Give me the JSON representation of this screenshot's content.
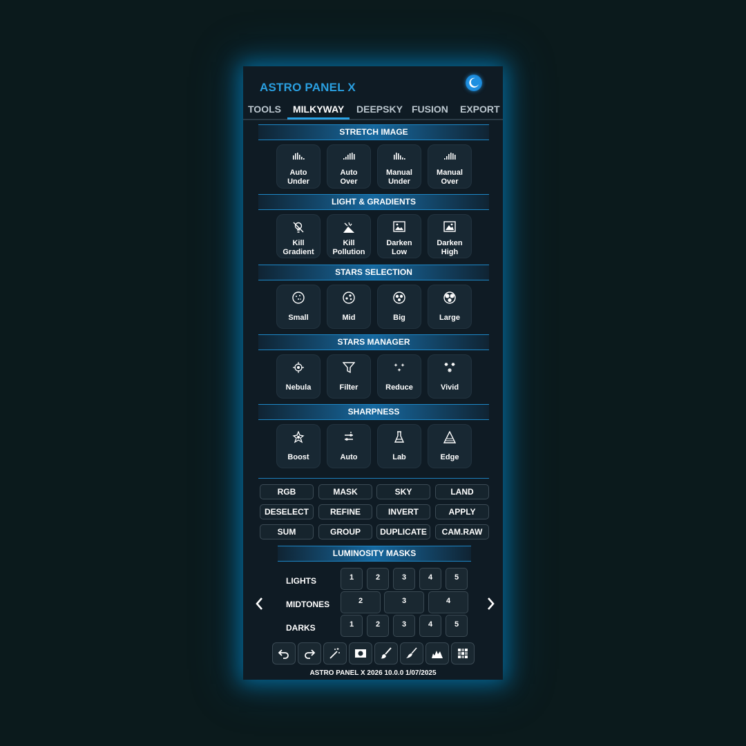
{
  "app": {
    "title": "ASTRO PANEL X",
    "theme_icon": "moon-icon",
    "accent": "#2a9fe0"
  },
  "tabs": [
    {
      "label": "TOOLS"
    },
    {
      "label": "MILKYWAY",
      "active": true
    },
    {
      "label": "DEEPSKY"
    },
    {
      "label": "FUSION"
    },
    {
      "label": "EXPORT"
    }
  ],
  "sections": {
    "stretch": {
      "title": "STRETCH IMAGE",
      "items": [
        {
          "line1": "Auto",
          "line2": "Under",
          "icon": "histogram-icon"
        },
        {
          "line1": "Auto",
          "line2": "Over",
          "icon": "histogram-icon"
        },
        {
          "line1": "Manual",
          "line2": "Under",
          "icon": "histogram-icon"
        },
        {
          "line1": "Manual",
          "line2": "Over",
          "icon": "histogram-icon"
        }
      ]
    },
    "light": {
      "title": "LIGHT & GRADIENTS",
      "items": [
        {
          "line1": "Kill",
          "line2": "Gradient",
          "icon": "bulb-off-icon"
        },
        {
          "line1": "Kill",
          "line2": "Pollution",
          "icon": "pollution-icon"
        },
        {
          "line1": "Darken",
          "line2": "Low",
          "icon": "image-frame-icon"
        },
        {
          "line1": "Darken",
          "line2": "High",
          "icon": "image-frame-icon"
        }
      ]
    },
    "stars_selection": {
      "title": "STARS SELECTION",
      "items": [
        {
          "label": "Small",
          "icon": "stars-small-icon"
        },
        {
          "label": "Mid",
          "icon": "stars-mid-icon"
        },
        {
          "label": "Big",
          "icon": "stars-big-icon"
        },
        {
          "label": "Large",
          "icon": "stars-large-icon"
        }
      ]
    },
    "stars_manager": {
      "title": "STARS MANAGER",
      "items": [
        {
          "label": "Nebula",
          "icon": "nebula-icon"
        },
        {
          "label": "Filter",
          "icon": "filter-icon"
        },
        {
          "label": "Reduce",
          "icon": "reduce-stars-icon"
        },
        {
          "label": "Vivid",
          "icon": "vivid-stars-icon"
        }
      ]
    },
    "sharpness": {
      "title": "SHARPNESS",
      "items": [
        {
          "label": "Boost",
          "icon": "star-burst-icon"
        },
        {
          "label": "Auto",
          "icon": "sliders-icon"
        },
        {
          "label": "Lab",
          "icon": "flask-icon"
        },
        {
          "label": "Edge",
          "icon": "triangle-icon"
        }
      ]
    }
  },
  "grid_buttons": [
    "RGB",
    "MASK",
    "SKY",
    "LAND",
    "DESELECT",
    "REFINE",
    "INVERT",
    "APPLY",
    "SUM",
    "GROUP",
    "DUPLICATE",
    "CAM.RAW"
  ],
  "luminosity": {
    "title": "LUMINOSITY MASKS",
    "lights_label": "LIGHTS",
    "midtones_label": "MIDTONES",
    "darks_label": "DARKS",
    "lights": [
      "1",
      "2",
      "3",
      "4",
      "5"
    ],
    "midtones": [
      "2",
      "3",
      "4"
    ],
    "darks": [
      "1",
      "2",
      "3",
      "4",
      "5"
    ]
  },
  "toolbar": [
    "undo-icon",
    "redo-icon",
    "magic-wand-icon",
    "mask-icon",
    "brush-icon",
    "brush-alt-icon",
    "histogram-icon",
    "grid-icon"
  ],
  "footer": "ASTRO PANEL X 2026 10.0.0 1/07/2025"
}
